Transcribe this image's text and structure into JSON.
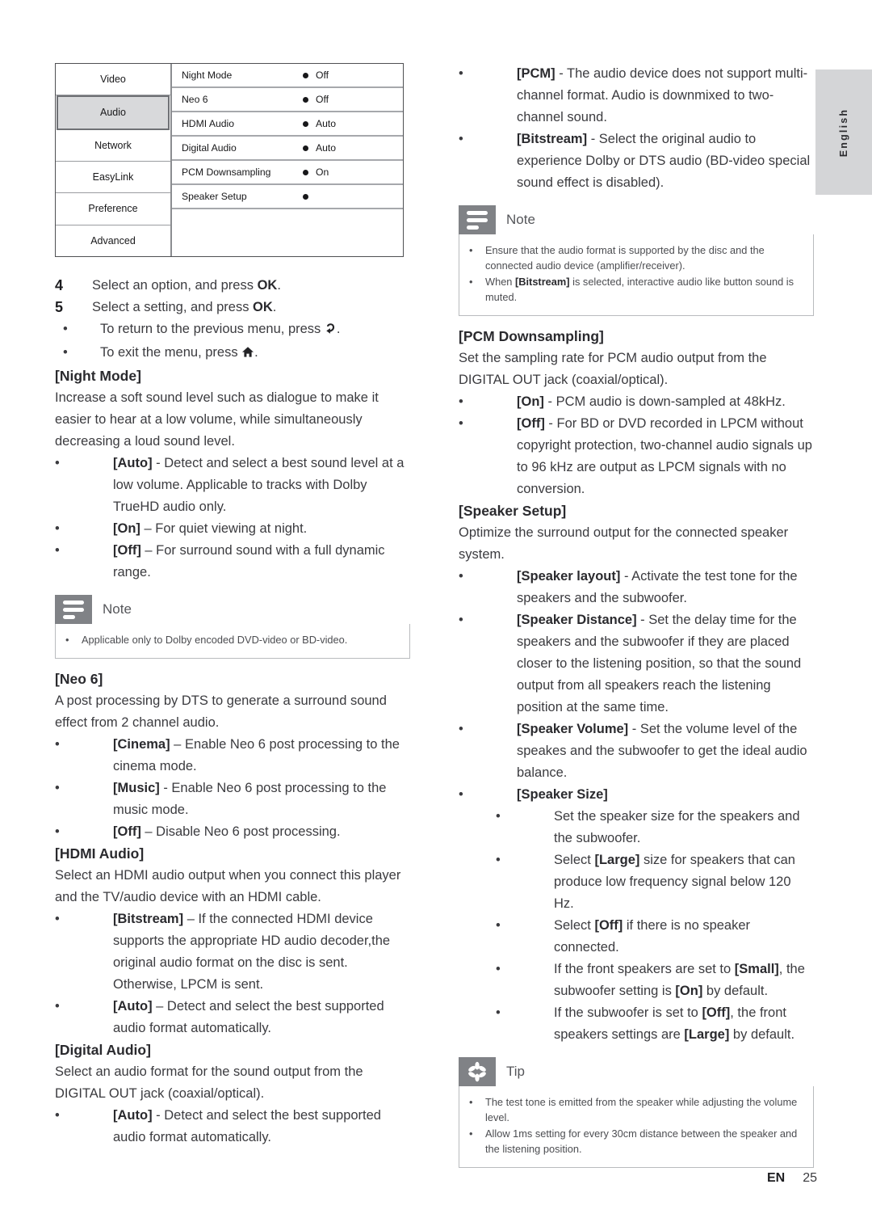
{
  "language_tab": {
    "label": "English"
  },
  "footer": {
    "locale": "EN",
    "page_number": "25"
  },
  "osd_menu": {
    "categories": [
      {
        "label": "Video",
        "selected": false
      },
      {
        "label": "Audio",
        "selected": true
      },
      {
        "label": "Network",
        "selected": false
      },
      {
        "label": "EasyLink",
        "selected": false
      },
      {
        "label": "Preference",
        "selected": false
      },
      {
        "label": "Advanced",
        "selected": false
      }
    ],
    "rows": [
      {
        "label": "Night Mode",
        "value": "Off"
      },
      {
        "label": "Neo 6",
        "value": "Off"
      },
      {
        "label": "HDMI Audio",
        "value": "Auto"
      },
      {
        "label": "Digital Audio",
        "value": "Auto"
      },
      {
        "label": "PCM Downsampling",
        "value": "On"
      },
      {
        "label": "Speaker Setup",
        "value": ""
      }
    ]
  },
  "left_column": {
    "step4": {
      "num": "4",
      "text_a": "Select an option, and press ",
      "text_b": "OK",
      "text_c": "."
    },
    "step5": {
      "num": "5",
      "text_a": "Select a setting, and press ",
      "text_b": "OK",
      "text_c": "."
    },
    "step5_bullets": [
      {
        "text_a": "To return to the previous menu, press ",
        "icon": "return-arrow-icon",
        "text_c": "."
      },
      {
        "text_a": "To exit the menu, press ",
        "icon": "home-icon",
        "text_c": "."
      }
    ],
    "night_mode": {
      "heading": "[Night Mode]",
      "body": "Increase a soft sound level such as dialogue to make it easier to hear at a low volume, while simultaneously decreasing a loud sound level.",
      "bullets": [
        {
          "bold": "[Auto]",
          "rest": " - Detect and select a best sound level at a low volume. Applicable to tracks with Dolby TrueHD audio only."
        },
        {
          "bold": "[On]",
          "rest": " – For quiet viewing at night."
        },
        {
          "bold": "[Off]",
          "rest": " – For surround sound with a full dynamic range."
        }
      ]
    },
    "note_night_mode": {
      "icon": "note-icon",
      "title": "Note",
      "items": [
        {
          "text_a": "Applicable only to Dolby encoded DVD-video or BD-video."
        }
      ]
    },
    "neo6": {
      "heading": "[Neo 6]",
      "body": "A post processing by DTS to generate a surround sound effect from 2 channel audio.",
      "bullets": [
        {
          "bold": "[Cinema]",
          "rest": " – Enable Neo 6 post processing to the cinema mode."
        },
        {
          "bold": "[Music]",
          "rest": " - Enable Neo 6 post processing to the music mode."
        },
        {
          "bold": "[Off]",
          "rest": " – Disable Neo 6 post processing."
        }
      ]
    },
    "hdmi_audio": {
      "heading": "[HDMI Audio]",
      "body": "Select an HDMI audio output when you connect this player and the TV/audio device with an HDMI cable.",
      "bullets": [
        {
          "bold": "[Bitstream]",
          "rest": " – If the connected HDMI device supports the appropriate HD audio decoder,the original audio format on the disc is sent. Otherwise, LPCM is sent."
        },
        {
          "bold": "[Auto]",
          "rest": " – Detect and select the best supported audio format automatically."
        }
      ]
    },
    "digital_audio": {
      "heading": "[Digital Audio]",
      "body": "Select an audio format for the sound output from the DIGITAL OUT jack (coaxial/optical).",
      "bullets": [
        {
          "bold": "[Auto]",
          "rest": " - Detect and select the best supported audio format automatically."
        }
      ]
    }
  },
  "right_column": {
    "digital_audio_cont_bullets": [
      {
        "bold": "[PCM]",
        "rest": " - The audio device does not support multi-channel format. Audio is downmixed to two-channel sound."
      },
      {
        "bold": "[Bitstream]",
        "rest": " - Select the original audio to experience Dolby or DTS audio (BD-video special sound effect is disabled)."
      }
    ],
    "note_digital_audio": {
      "icon": "note-icon",
      "title": "Note",
      "items": [
        {
          "text_a": "Ensure that the audio format is supported by the disc and the connected audio device (amplifier/receiver)."
        },
        {
          "text_a": "When ",
          "bold": "[Bitstream]",
          "text_b": " is selected, interactive audio like button sound is muted."
        }
      ]
    },
    "pcm_downsampling": {
      "heading": "[PCM Downsampling]",
      "body": "Set the sampling rate for PCM audio output from the DIGITAL OUT jack (coaxial/optical).",
      "bullets": [
        {
          "bold": "[On]",
          "rest": " - PCM audio is down-sampled at 48kHz."
        },
        {
          "bold": "[Off]",
          "rest": " - For BD or DVD recorded in LPCM without copyright protection, two-channel audio signals up to 96 kHz are output as LPCM signals with no conversion."
        }
      ]
    },
    "speaker_setup": {
      "heading": "[Speaker Setup]",
      "body": "Optimize the surround output for the connected speaker system.",
      "bullets": [
        {
          "bold": "[Speaker layout]",
          "rest": " - Activate the test tone for the speakers and the subwoofer."
        },
        {
          "bold": "[Speaker Distance]",
          "rest": " - Set the delay time for the speakers and the subwoofer if they are placed closer to the listening position, so that the sound output from all speakers reach the listening position at the same time."
        },
        {
          "bold": "[Speaker Volume]",
          "rest": " - Set the volume level of the speakes and the subwoofer to get the ideal audio balance."
        },
        {
          "bold": "[Speaker Size]",
          "rest": ""
        }
      ],
      "speaker_size_sub": [
        {
          "pre": "Set the speaker size for the speakers and the subwoofer.",
          "bold": "",
          "post": ""
        },
        {
          "pre": "Select ",
          "bold": "[Large]",
          "post": " size for speakers that can produce low frequency signal below 120 Hz."
        },
        {
          "pre": "Select ",
          "bold": "[Off]",
          "post": " if there is no speaker connected."
        },
        {
          "pre": "If the front speakers are set to ",
          "bold": "[Small]",
          "post": ", the subwoofer setting is ",
          "bold2": "[On]",
          "post2": " by default."
        },
        {
          "pre": "If the subwoofer is set to ",
          "bold": "[Off]",
          "post": ", the front speakers settings are ",
          "bold2": "[Large]",
          "post2": " by default."
        }
      ]
    },
    "tip": {
      "icon": "tip-icon",
      "title": "Tip",
      "items": [
        {
          "text_a": "The test tone is emitted from the speaker while adjusting the volume level."
        },
        {
          "text_a": "Allow 1ms setting for every 30cm distance between the speaker and the listening position."
        }
      ]
    }
  }
}
